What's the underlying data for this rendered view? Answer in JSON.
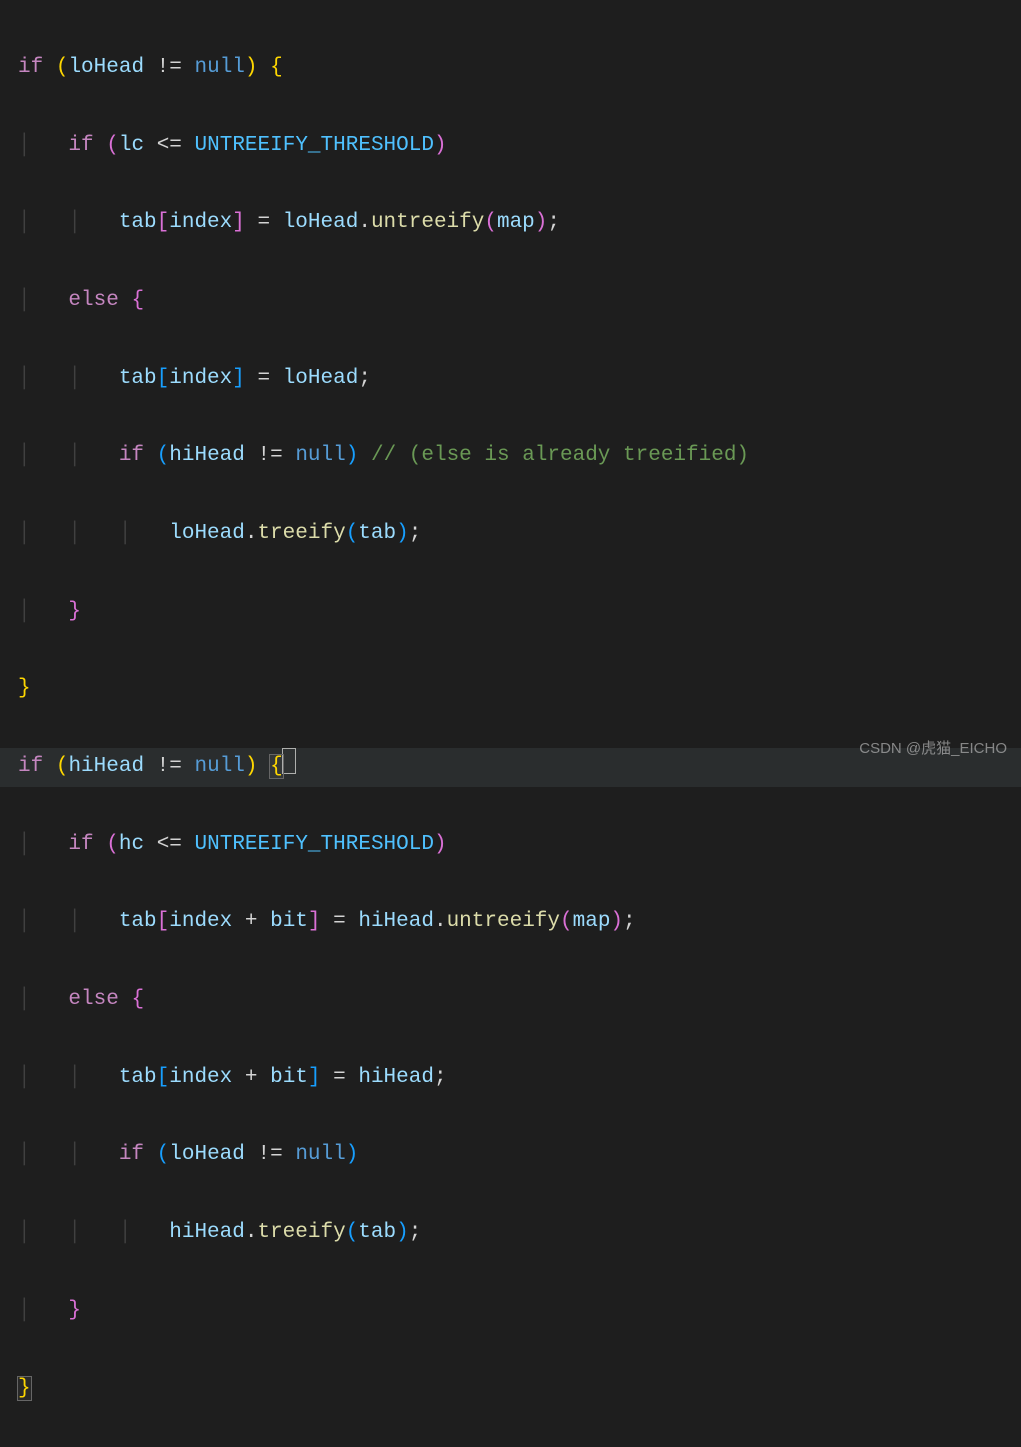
{
  "code": {
    "kw_if": "if",
    "kw_else": "else",
    "kw_null": "null",
    "var_loHead": "loHead",
    "var_hiHead": "hiHead",
    "var_lc": "lc",
    "var_hc": "hc",
    "var_tab": "tab",
    "var_index": "index",
    "var_bit": "bit",
    "var_map": "map",
    "const_threshold": "UNTREEIFY_THRESHOLD",
    "fn_untreeify": "untreeify",
    "fn_treeify": "treeify",
    "cmt_already": "// (else is already treeified)",
    "op_ne": "!=",
    "op_le": "<=",
    "op_eq": "=",
    "op_plus": "+",
    "sym_lbrace": "{",
    "sym_rbrace": "}",
    "sym_lparen": "(",
    "sym_rparen": ")",
    "sym_lbracket": "[",
    "sym_rbracket": "]",
    "sym_semi": ";",
    "sym_dot": ".",
    "sym_space": " "
  },
  "watermark": "CSDN @虎猫_EICHO"
}
